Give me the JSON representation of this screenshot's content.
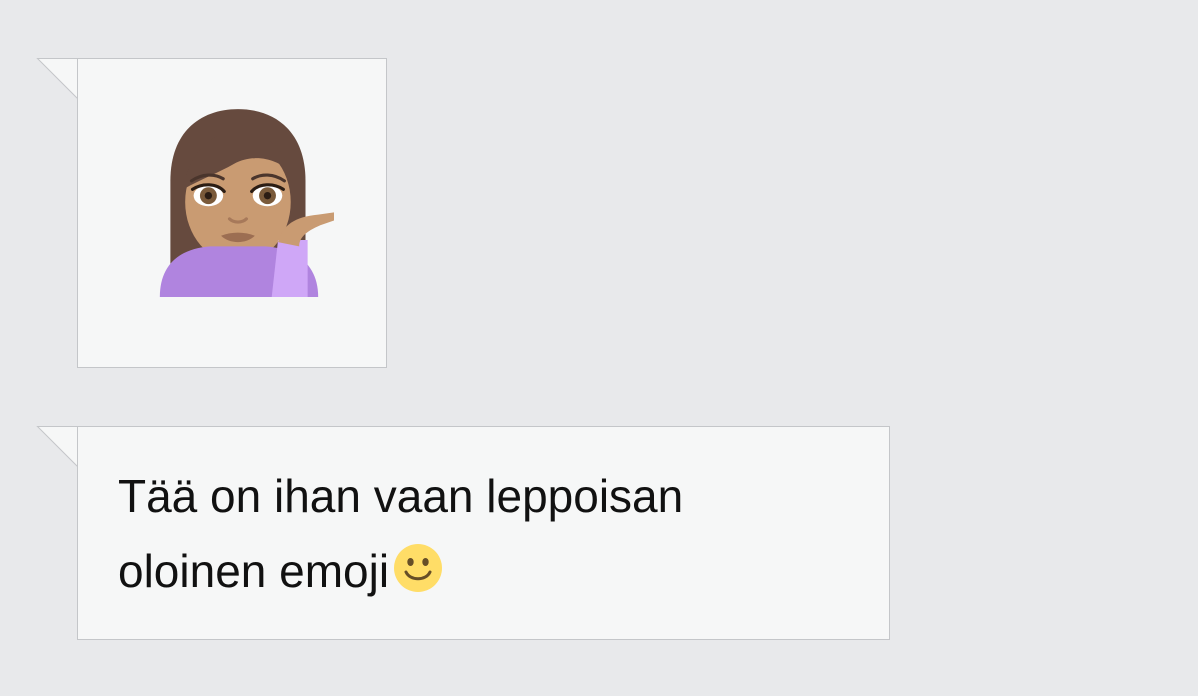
{
  "conversation": {
    "messages": [
      {
        "type": "emoji",
        "emoji_icon": "woman-tipping-hand-icon"
      },
      {
        "type": "text",
        "line1": "Tää on ihan vaan leppoisan",
        "line2": "oloinen emoji",
        "trailing_icon": "slightly-smiling-face-icon"
      }
    ]
  },
  "colors": {
    "background": "#e8e9eb",
    "bubble_fill": "#f6f7f7",
    "bubble_border": "#c4c6c9"
  }
}
